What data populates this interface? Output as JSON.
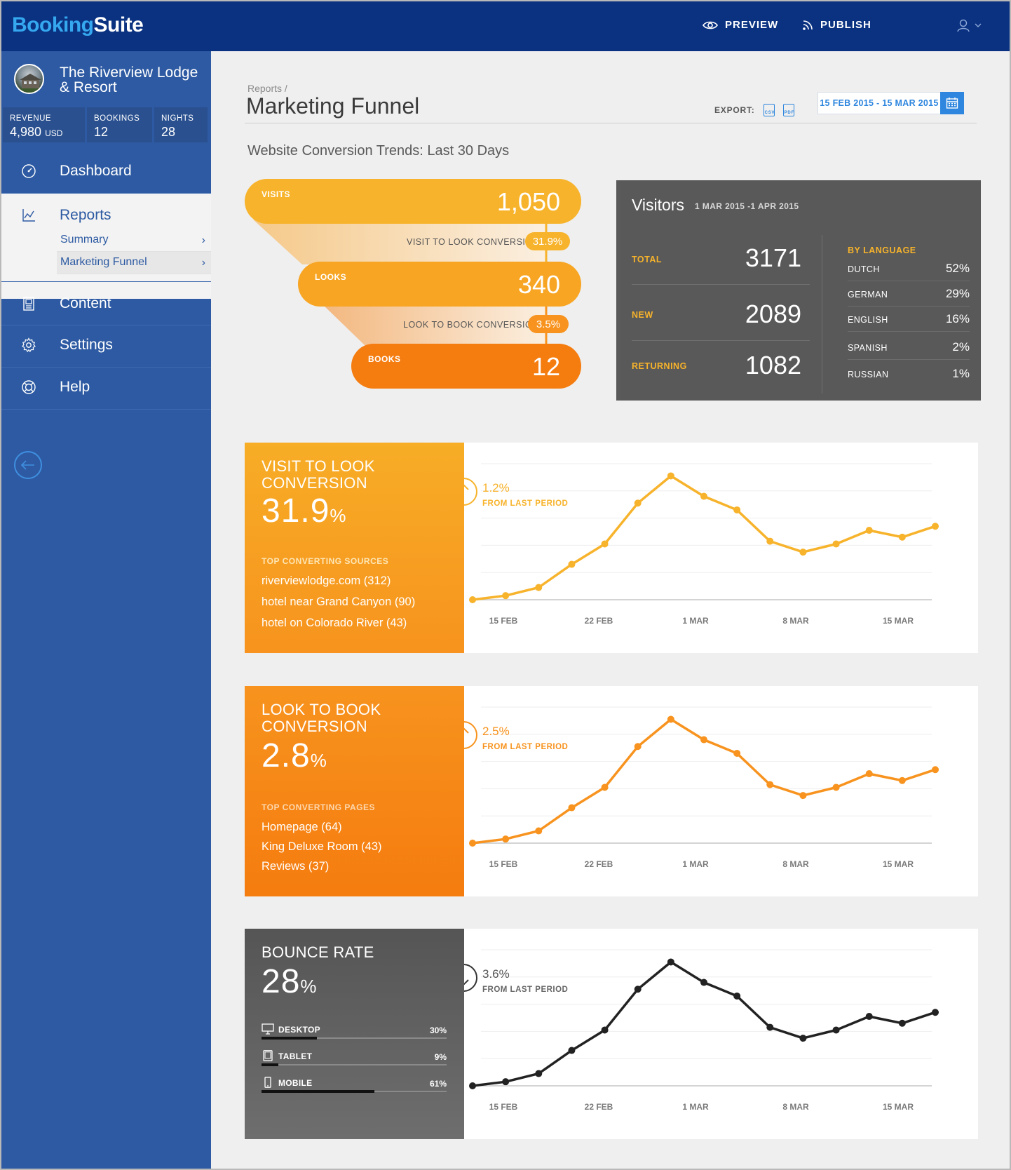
{
  "app": {
    "brand_a": "Booking",
    "brand_b": "Suite"
  },
  "topbar": {
    "preview_label": "PREVIEW",
    "publish_label": "PUBLISH"
  },
  "hotel": {
    "name_line1": "The Riverview Lodge",
    "name_line2": "& Resort"
  },
  "stats": {
    "revenue_label": "REVENUE",
    "revenue_value": "4,980",
    "revenue_unit": "USD",
    "bookings_label": "BOOKINGS",
    "bookings_value": "12",
    "nights_label": "NIGHTS",
    "nights_value": "28"
  },
  "nav": {
    "dashboard": "Dashboard",
    "reports": "Reports",
    "summary": "Summary",
    "marketing_funnel": "Marketing Funnel",
    "content": "Content",
    "settings": "Settings",
    "help": "Help"
  },
  "header": {
    "breadcrumb": "Reports /",
    "title": "Marketing Funnel",
    "export_label": "EXPORT:",
    "csv": "CSV",
    "pdf": "PDF",
    "date_range": "15 FEB 2015 - 15 MAR 2015"
  },
  "section_title": "Website Conversion Trends: Last 30 Days",
  "funnel": {
    "visits_label": "VISITS",
    "visits_value": "1,050",
    "visit_to_look_label": "VISIT TO LOOK CONVERSION",
    "visit_to_look_value": "31.9%",
    "looks_label": "LOOKS",
    "looks_value": "340",
    "look_to_book_label": "LOOK TO BOOK CONVERSION",
    "look_to_book_value": "3.5%",
    "books_label": "BOOKS",
    "books_value": "12"
  },
  "visitors": {
    "title": "Visitors",
    "range": "1 MAR 2015 -1 APR 2015",
    "total_label": "TOTAL",
    "total_value": "3171",
    "new_label": "NEW",
    "new_value": "2089",
    "returning_label": "RETURNING",
    "returning_value": "1082",
    "by_language_label": "BY LANGUAGE",
    "languages": [
      {
        "name": "DUTCH",
        "pct": "52%"
      },
      {
        "name": "GERMAN",
        "pct": "29%"
      },
      {
        "name": "ENGLISH",
        "pct": "16%"
      },
      {
        "name": "SPANISH",
        "pct": "2%"
      },
      {
        "name": "RUSSIAN",
        "pct": "1%"
      }
    ]
  },
  "cards": {
    "visit_to_look": {
      "title": "VISIT TO LOOK CONVERSION",
      "value": "31.9",
      "unit": "%",
      "sub_label": "TOP CONVERTING SOURCES",
      "items": [
        "riverviewlodge.com (312)",
        "hotel near Grand Canyon (90)",
        "hotel on Colorado River (43)"
      ],
      "change": "1.2%",
      "change_label": "FROM LAST PERIOD"
    },
    "look_to_book": {
      "title": "LOOK TO BOOK CONVERSION",
      "value": "2.8",
      "unit": "%",
      "sub_label": "TOP CONVERTING PAGES",
      "items": [
        "Homepage (64)",
        "King Deluxe Room (43)",
        "Reviews (37)"
      ],
      "change": "2.5%",
      "change_label": "FROM LAST PERIOD"
    },
    "bounce": {
      "title": "BOUNCE RATE",
      "value": "28",
      "unit": "%",
      "devices": [
        {
          "label": "DESKTOP",
          "pct": "30%",
          "fraction": 0.3
        },
        {
          "label": "TABLET",
          "pct": "9%",
          "fraction": 0.09
        },
        {
          "label": "MOBILE",
          "pct": "61%",
          "fraction": 0.61
        }
      ],
      "change": "3.6%",
      "change_label": "FROM LAST PERIOD"
    }
  },
  "colors": {
    "brand_blue": "#0a3281",
    "sidebar": "#2d5aa2",
    "yellow": "#f7b32b",
    "orange": "#f7931e",
    "dark_orange": "#f57c0f",
    "dark": "#222222"
  },
  "chart_data": [
    {
      "type": "line",
      "x_ticks": [
        "15 FEB",
        "22 FEB",
        "1 MAR",
        "8 MAR",
        "15 MAR"
      ],
      "y": [
        0.0,
        0.3,
        0.9,
        2.6,
        4.1,
        7.1,
        9.1,
        7.6,
        6.6,
        4.3,
        3.5,
        4.1,
        5.1,
        4.6,
        5.4
      ],
      "ylim": [
        0,
        10
      ],
      "color": "#f7b32b",
      "grid": true
    },
    {
      "type": "line",
      "x_ticks": [
        "15 FEB",
        "22 FEB",
        "1 MAR",
        "8 MAR",
        "15 MAR"
      ],
      "y": [
        0.0,
        0.3,
        0.9,
        2.6,
        4.1,
        7.1,
        9.1,
        7.6,
        6.6,
        4.3,
        3.5,
        4.1,
        5.1,
        4.6,
        5.4
      ],
      "ylim": [
        0,
        10
      ],
      "color": "#f7931e",
      "grid": true
    },
    {
      "type": "line",
      "x_ticks": [
        "15 FEB",
        "22 FEB",
        "1 MAR",
        "8 MAR",
        "15 MAR"
      ],
      "y": [
        0.0,
        0.3,
        0.9,
        2.6,
        4.1,
        7.1,
        9.1,
        7.6,
        6.6,
        4.3,
        3.5,
        4.1,
        5.1,
        4.6,
        5.4
      ],
      "ylim": [
        0,
        10
      ],
      "color": "#222222",
      "grid": true
    }
  ]
}
